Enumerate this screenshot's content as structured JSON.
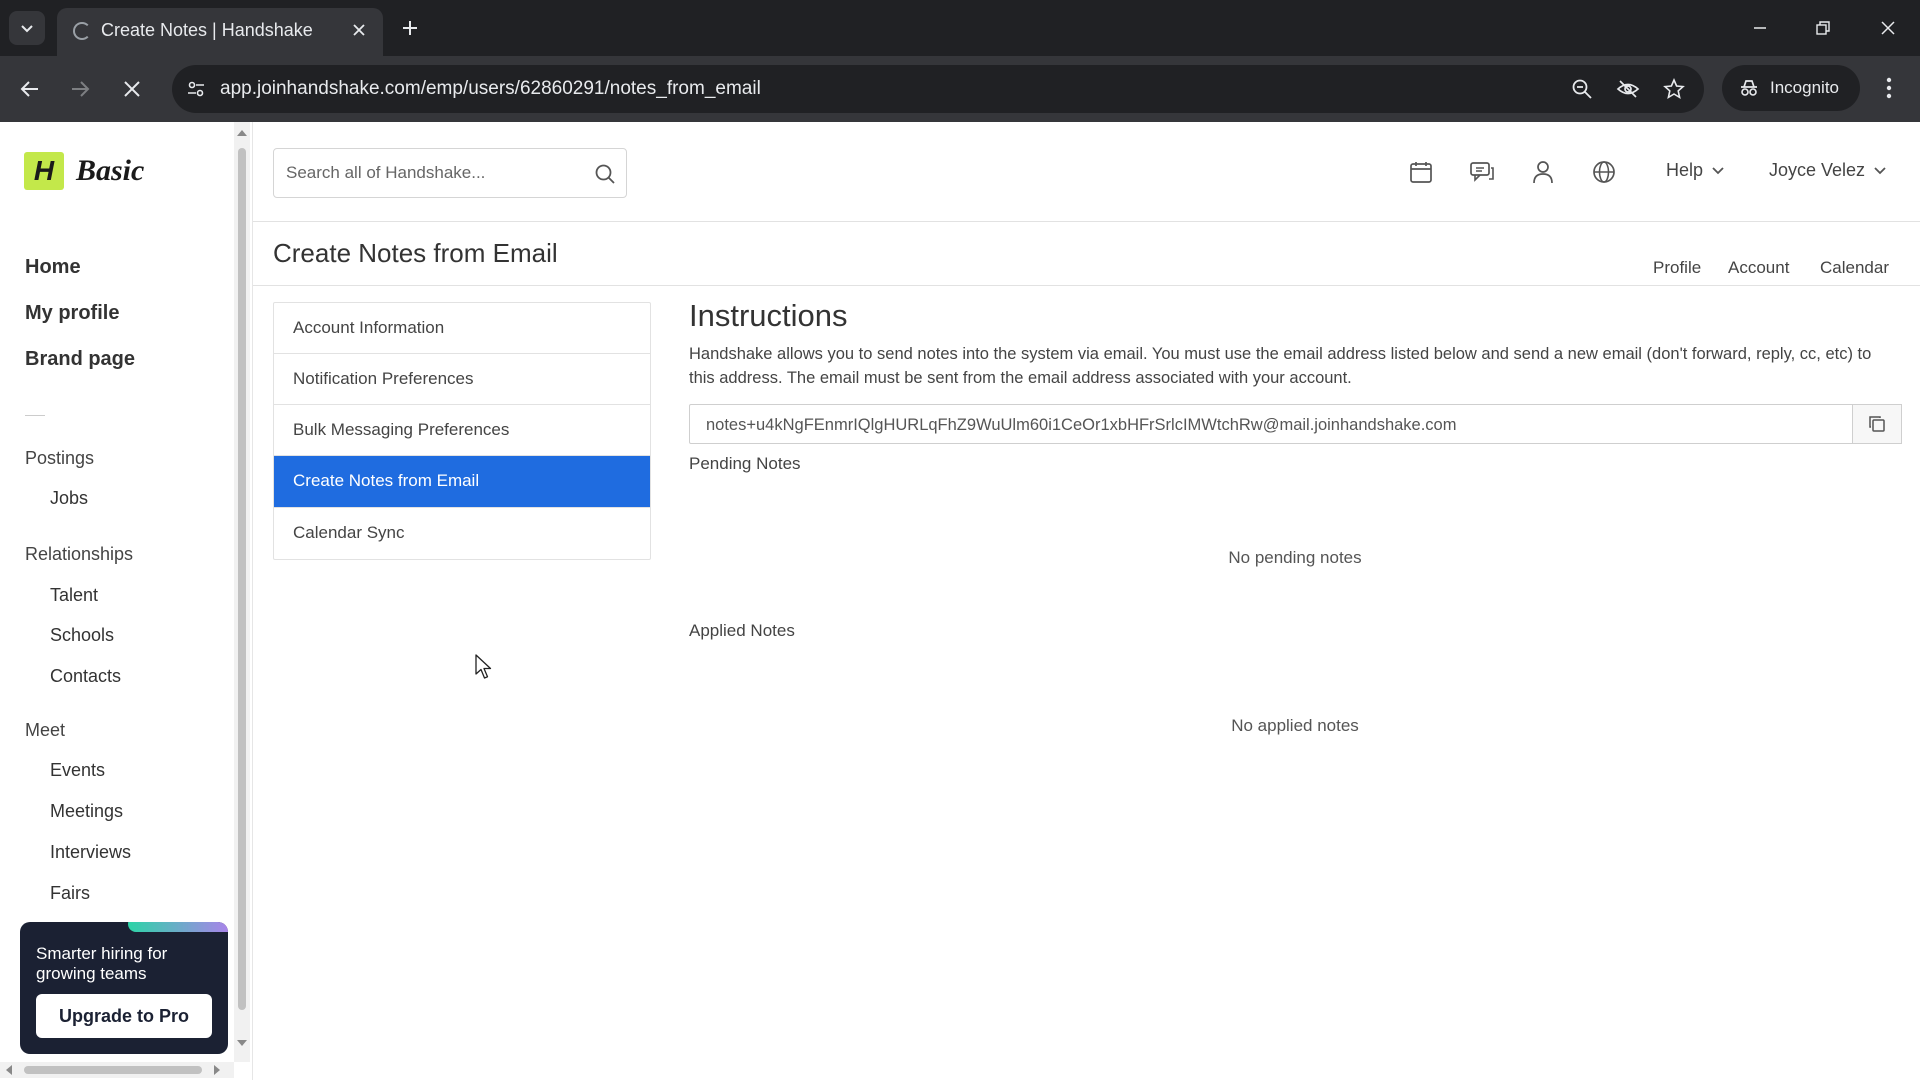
{
  "browser": {
    "tab_title": "Create Notes | Handshake",
    "url": "app.joinhandshake.com/emp/users/62860291/notes_from_email",
    "incognito_label": "Incognito"
  },
  "brand": {
    "logo_letter": "H",
    "plan": "Basic",
    "accent": "#c3e84a",
    "primary": "#1f6ce0"
  },
  "sidebar": {
    "main": [
      "Home",
      "My profile",
      "Brand page"
    ],
    "postings": {
      "label": "Postings",
      "items": [
        "Jobs"
      ]
    },
    "relationships": {
      "label": "Relationships",
      "items": [
        "Talent",
        "Schools",
        "Contacts"
      ]
    },
    "meet": {
      "label": "Meet",
      "items": [
        "Events",
        "Meetings",
        "Interviews",
        "Fairs"
      ]
    },
    "promo": {
      "text": "Smarter hiring for growing teams",
      "button": "Upgrade to Pro"
    }
  },
  "header": {
    "search_placeholder": "Search all of Handshake...",
    "help_label": "Help",
    "user_name": "Joyce Velez"
  },
  "page": {
    "title": "Create Notes from Email",
    "links": [
      "Profile",
      "Account",
      "Calendar"
    ]
  },
  "settings_nav": {
    "items": [
      "Account Information",
      "Notification Preferences",
      "Bulk Messaging Preferences",
      "Create Notes from Email",
      "Calendar Sync"
    ],
    "active_index": 3
  },
  "main": {
    "heading": "Instructions",
    "text": "Handshake allows you to send notes into the system via email. You must use the email address listed below and send a new email (don't forward, reply, cc, etc) to this address. The email must be sent from the email address associated with your account.",
    "email": "notes+u4kNgFEnmrIQlgHURLqFhZ9WuUlm60i1CeOr1xbHFrSrlcIMWtchRw@mail.joinhandshake.com",
    "pending_label": "Pending Notes",
    "pending_empty": "No pending notes",
    "applied_label": "Applied Notes",
    "applied_empty": "No applied notes"
  }
}
